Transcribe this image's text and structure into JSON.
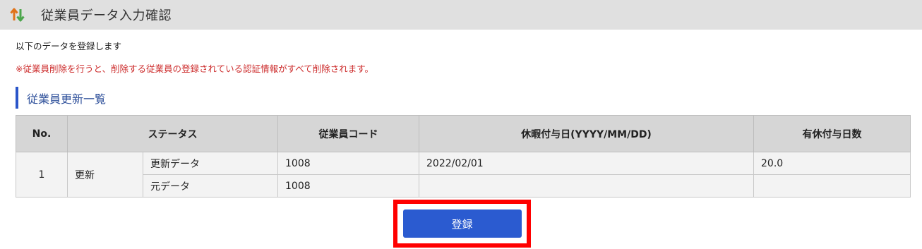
{
  "header": {
    "title": "従業員データ入力確認",
    "icon": "sort-arrows-icon"
  },
  "info_text": "以下のデータを登録します",
  "warning_text": "※従業員削除を行うと、削除する従業員の登録されている認証情報がすべて削除されます。",
  "section_title": "従業員更新一覧",
  "table": {
    "headers": [
      "No.",
      "ステータス",
      "従業員コード",
      "休暇付与日(YYYY/MM/DD)",
      "有休付与日数"
    ],
    "row": {
      "no": "1",
      "status": "更新",
      "sub_rows": [
        {
          "label": "更新データ",
          "code": "1008",
          "date": "2022/02/01",
          "days": "20.0"
        },
        {
          "label": "元データ",
          "code": "1008",
          "date": "",
          "days": ""
        }
      ]
    }
  },
  "submit_button": "登録",
  "colors": {
    "accent": "#2b5bd0",
    "warning": "#cc2a2a",
    "highlight": "#ff0000"
  }
}
